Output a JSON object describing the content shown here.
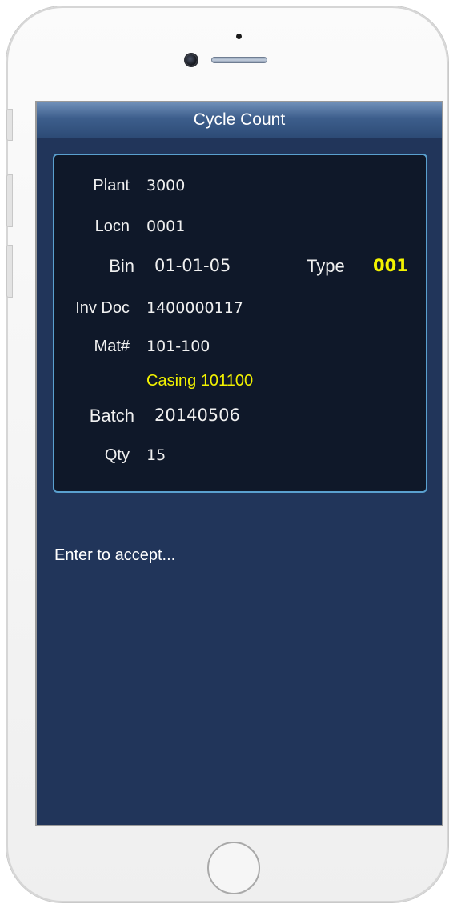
{
  "app": {
    "title": "Cycle Count"
  },
  "fields": {
    "plant": {
      "label": "Plant",
      "value": "3000"
    },
    "locn": {
      "label": "Locn",
      "value": "0001"
    },
    "bin": {
      "label": "Bin",
      "value": "01-01-05"
    },
    "type": {
      "label": "Type",
      "value": "001"
    },
    "inv_doc": {
      "label": "Inv Doc",
      "value": "1400000117"
    },
    "mat": {
      "label": "Mat#",
      "value": "101-100"
    },
    "description": "Casing  101100",
    "batch": {
      "label": "Batch",
      "value": "20140506"
    },
    "qty": {
      "label": "Qty",
      "value": "15"
    }
  },
  "prompt": "Enter to accept...",
  "colors": {
    "screen_bg": "#21355a",
    "card_bg": "#0f1829",
    "card_border": "#5aa0cf",
    "highlight": "#f2f200"
  }
}
